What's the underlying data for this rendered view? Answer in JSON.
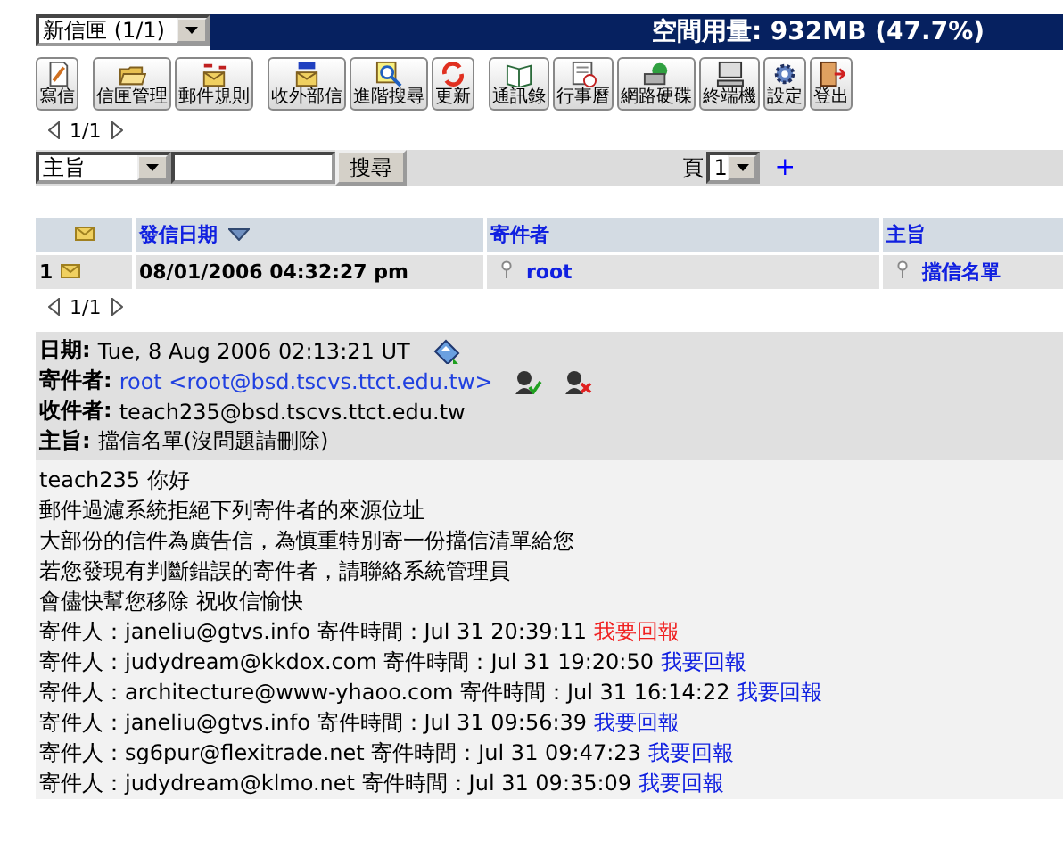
{
  "folder_select": {
    "value": "新信匣 (1/1)"
  },
  "quota": "空間用量: 932MB (47.7%)",
  "toolbar": [
    [
      {
        "label": "寫信"
      }
    ],
    [
      {
        "label": "信匣管理"
      },
      {
        "label": "郵件規則"
      }
    ],
    [
      {
        "label": "收外部信"
      },
      {
        "label": "進階搜尋"
      },
      {
        "label": "更新"
      }
    ],
    [
      {
        "label": "通訊錄"
      },
      {
        "label": "行事曆"
      },
      {
        "label": "網路硬碟"
      },
      {
        "label": "終端機"
      },
      {
        "label": "設定"
      },
      {
        "label": "登出"
      }
    ]
  ],
  "pager_top": "1/1",
  "search": {
    "field": "主旨",
    "button": "搜尋",
    "page_label": "頁",
    "page": "1",
    "plus": "+"
  },
  "table": {
    "columns": [
      {
        "label": "發信日期",
        "sorted": true
      },
      {
        "label": "寄件者",
        "sorted": false
      },
      {
        "label": "主旨",
        "sorted": false
      }
    ],
    "rows": [
      {
        "number": "1",
        "date": "08/01/2006 04:32:27 pm",
        "sender": "root",
        "subject": "擋信名單"
      }
    ]
  },
  "pager_bottom": "1/1",
  "header": [
    {
      "label": "日期:",
      "value": "Tue, 8 Aug 2006 02:13:21 UT",
      "kind": "date"
    },
    {
      "label": "寄件者:",
      "value": "root <root@bsd.tscvs.ttct.edu.tw>",
      "kind": "sender"
    },
    {
      "label": "收件者:",
      "value": "teach235@bsd.tscvs.ttct.edu.tw",
      "kind": "plain"
    },
    {
      "label": "主旨:",
      "value": "擋信名單(沒問題請刪除)",
      "kind": "plain"
    }
  ],
  "body": {
    "lines": [
      "teach235 你好",
      "郵件過濾系統拒絕下列寄件者的來源位址",
      "大部份的信件為廣告信，為慎重特別寄一份擋信清單給您",
      "若您發現有判斷錯誤的寄件者，請聯絡系統管理員",
      "會儘快幫您移除 祝收信愉快"
    ],
    "entries": [
      {
        "text": "寄件人：janeliu@gtvs.info 寄件時間：Jul 31 20:39:11",
        "link": "我要回報",
        "visited": true
      },
      {
        "text": "寄件人：judydream@kkdox.com 寄件時間：Jul 31 19:20:50",
        "link": "我要回報",
        "visited": false
      },
      {
        "text": "寄件人：architecture@www-yhaoo.com 寄件時間：Jul 31 16:14:22",
        "link": "我要回報",
        "visited": false
      },
      {
        "text": "寄件人：janeliu@gtvs.info 寄件時間：Jul 31 09:56:39",
        "link": "我要回報",
        "visited": false
      },
      {
        "text": "寄件人：sg6pur@flexitrade.net 寄件時間：Jul 31 09:47:23",
        "link": "我要回報",
        "visited": false
      },
      {
        "text": "寄件人：judydream@klmo.net 寄件時間：Jul 31 09:35:09",
        "link": "我要回報",
        "visited": false
      }
    ]
  }
}
